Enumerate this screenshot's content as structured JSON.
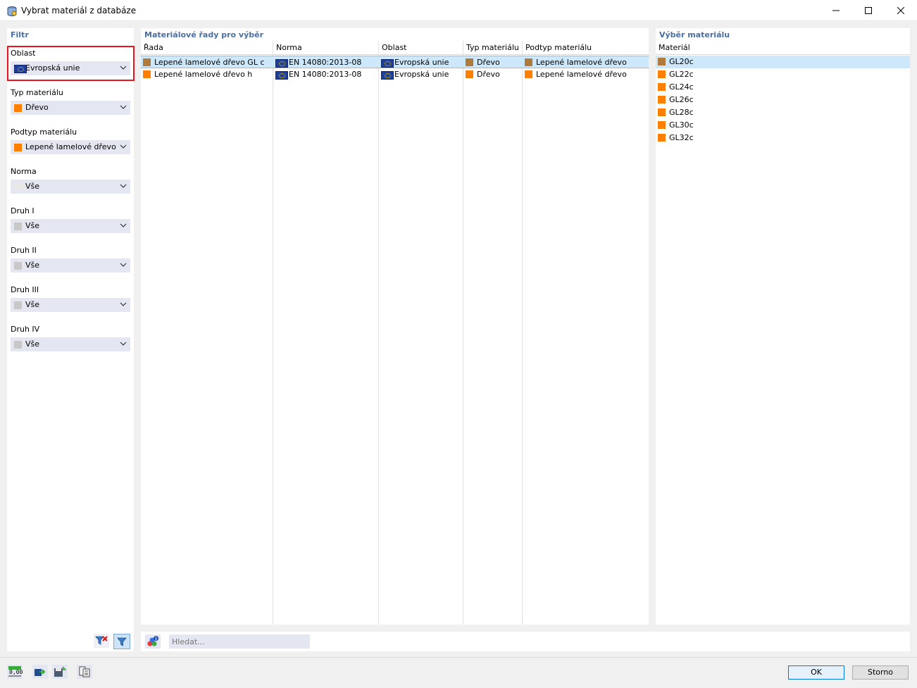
{
  "window": {
    "title": "Vybrat materiál z databáze"
  },
  "filter": {
    "title": "Filtr",
    "fields": [
      {
        "label": "Oblast",
        "value": "Evropská unie",
        "swatch": "flag-eu",
        "highlighted": true
      },
      {
        "label": "Typ materiálu",
        "value": "Dřevo",
        "swatch": "#ff7f00"
      },
      {
        "label": "Podtyp materiálu",
        "value": "Lepené lamelové dřevo",
        "swatch": "#ff7f00"
      },
      {
        "label": "Norma",
        "value": "Vše",
        "swatch": "#e8e8e8"
      },
      {
        "label": "Druh I",
        "value": "Vše",
        "swatch": "#c8c8c8"
      },
      {
        "label": "Druh II",
        "value": "Vše",
        "swatch": "#c8c8c8"
      },
      {
        "label": "Druh III",
        "value": "Vše",
        "swatch": "#c8c8c8"
      },
      {
        "label": "Druh IV",
        "value": "Vše",
        "swatch": "#c8c8c8"
      }
    ]
  },
  "series": {
    "title": "Materiálové řady pro výběr",
    "columns": [
      "Řada",
      "Norma",
      "Oblast",
      "Typ materiálu",
      "Podtyp materiálu"
    ],
    "rows": [
      {
        "rada": "Lepené lamelové dřevo GL c",
        "norma": "EN 14080:2013-08",
        "oblast": "Evropská unie",
        "typ": "Dřevo",
        "podtyp": "Lepené lamelové dřevo",
        "color": "#b07a3a",
        "selected": true
      },
      {
        "rada": "Lepené lamelové dřevo h",
        "norma": "EN 14080:2013-08",
        "oblast": "Evropská unie",
        "typ": "Dřevo",
        "podtyp": "Lepené lamelové dřevo",
        "color": "#ff7f00",
        "selected": false
      }
    ]
  },
  "materials": {
    "title": "Výběr materiálu",
    "column": "Materiál",
    "items": [
      {
        "name": "GL20c",
        "color": "#b07a3a",
        "selected": true
      },
      {
        "name": "GL22c",
        "color": "#ff7f00",
        "selected": false
      },
      {
        "name": "GL24c",
        "color": "#ff7f00",
        "selected": false
      },
      {
        "name": "GL26c",
        "color": "#ff7f00",
        "selected": false
      },
      {
        "name": "GL28c",
        "color": "#ff7f00",
        "selected": false
      },
      {
        "name": "GL30c",
        "color": "#ff7f00",
        "selected": false
      },
      {
        "name": "GL32c",
        "color": "#ff7f00",
        "selected": false
      }
    ]
  },
  "search": {
    "placeholder": "Hledat..."
  },
  "footer": {
    "units_label": "0,00",
    "ok_label": "OK",
    "cancel_label": "Storno"
  },
  "colors": {
    "panel_title": "#4a6fa5",
    "selection": "#cde8fb",
    "combo_bg": "#e4e6f1",
    "highlight_border": "#e8141e"
  }
}
